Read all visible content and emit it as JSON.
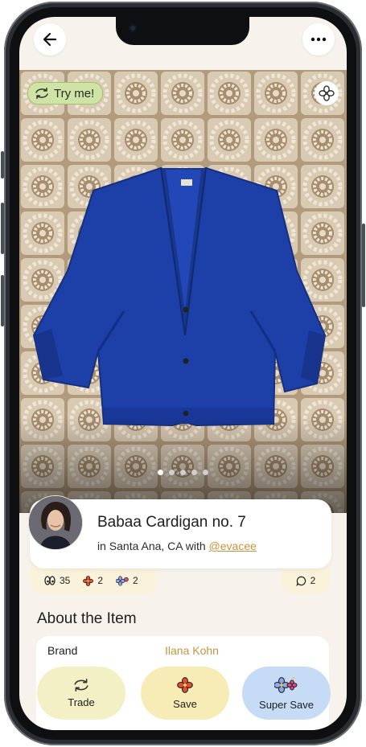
{
  "top_bar": {
    "back_icon": "arrow-left-icon",
    "more_icon": "ellipsis-icon"
  },
  "photo": {
    "try_me_label": "Try me!",
    "favorite_icon": "flower-outline-icon",
    "carousel_pages": 5,
    "carousel_active": 1
  },
  "item": {
    "title": "Babaa Cardigan no. 7",
    "location_prefix": "in Santa Ana, CA with ",
    "owner_handle": "@evacee"
  },
  "stats": {
    "views": "35",
    "saves": "2",
    "super_saves": "2",
    "comments": "2"
  },
  "about": {
    "heading": "About the Item",
    "rows": [
      {
        "label": "Brand",
        "value": "Ilana Kohn"
      }
    ]
  },
  "actions": {
    "trade_label": "Trade",
    "save_label": "Save",
    "super_save_label": "Super Save"
  },
  "colors": {
    "accent_link": "#c6953f",
    "try_pill": "#cfe3a5",
    "trade_bg": "#f3f0c6",
    "save_bg": "#f8ecb6",
    "super_save_bg": "#c6dbf6",
    "cardigan": "#1d3fa8"
  }
}
